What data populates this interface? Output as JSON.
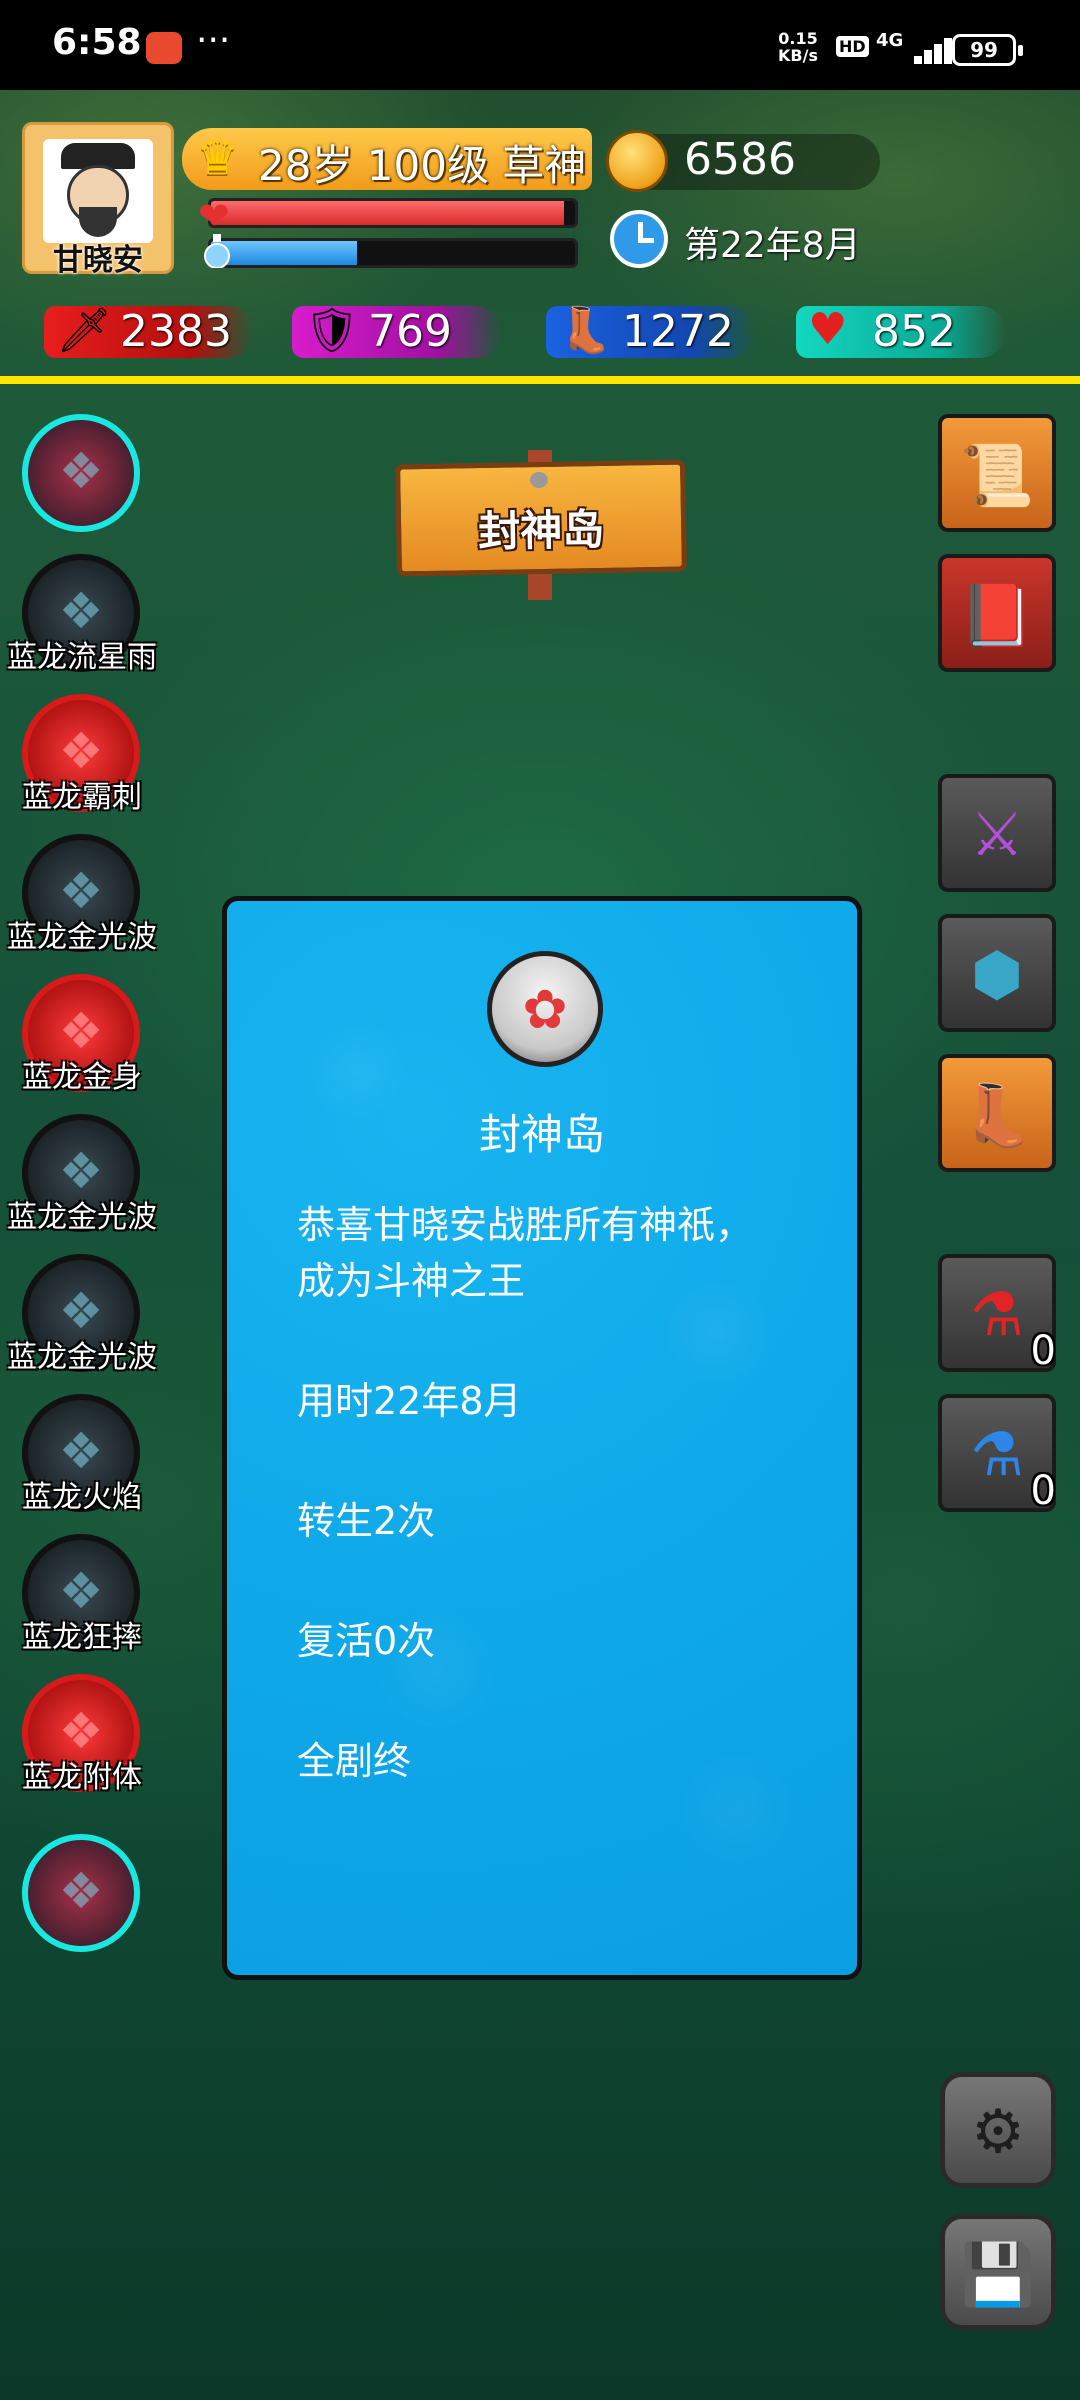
{
  "status_bar": {
    "time": "6:58",
    "more": "···",
    "net_speed_value": "0.15",
    "net_speed_unit": "KB/s",
    "hd": "HD",
    "signal": "4G",
    "battery": "99"
  },
  "player": {
    "name": "甘晓安",
    "rank": "28岁 100级 草神",
    "hp_fraction": 0.97,
    "mp_fraction": 0.4,
    "gold": "6586",
    "date": "第22年8月"
  },
  "stats": {
    "attack": "2383",
    "defense": "769",
    "speed": "1272",
    "health": "852"
  },
  "location_sign": "封神岛",
  "skills": [
    {
      "label": "",
      "state": "on"
    },
    {
      "label": "蓝龙流星雨",
      "state": "dim"
    },
    {
      "label": "蓝龙霸刺",
      "state": "red"
    },
    {
      "label": "蓝龙金光波",
      "state": "dim"
    },
    {
      "label": "蓝龙金身",
      "state": "red"
    },
    {
      "label": "蓝龙金光波",
      "state": "dim"
    },
    {
      "label": "蓝龙金光波",
      "state": "dim"
    },
    {
      "label": "蓝龙火焰",
      "state": "dim"
    },
    {
      "label": "蓝龙狂摔",
      "state": "dim"
    },
    {
      "label": "蓝龙附体",
      "state": "red"
    },
    {
      "label": "",
      "state": "on"
    }
  ],
  "inventory": {
    "red_potion_count": "0",
    "blue_potion_count": "0"
  },
  "dialog": {
    "title": "封神岛",
    "line1": "恭喜甘晓安战胜所有神祇，",
    "line2": "成为斗神之王",
    "time_used": "用时22年8月",
    "rebirths": "转生2次",
    "revives": "复活0次",
    "ending": "全剧终"
  },
  "colors": {
    "dialog_bg": "#0ea7e8",
    "hud_yellow": "#ffe600",
    "hp": "#d92b2b",
    "mp": "#1d88e0"
  }
}
